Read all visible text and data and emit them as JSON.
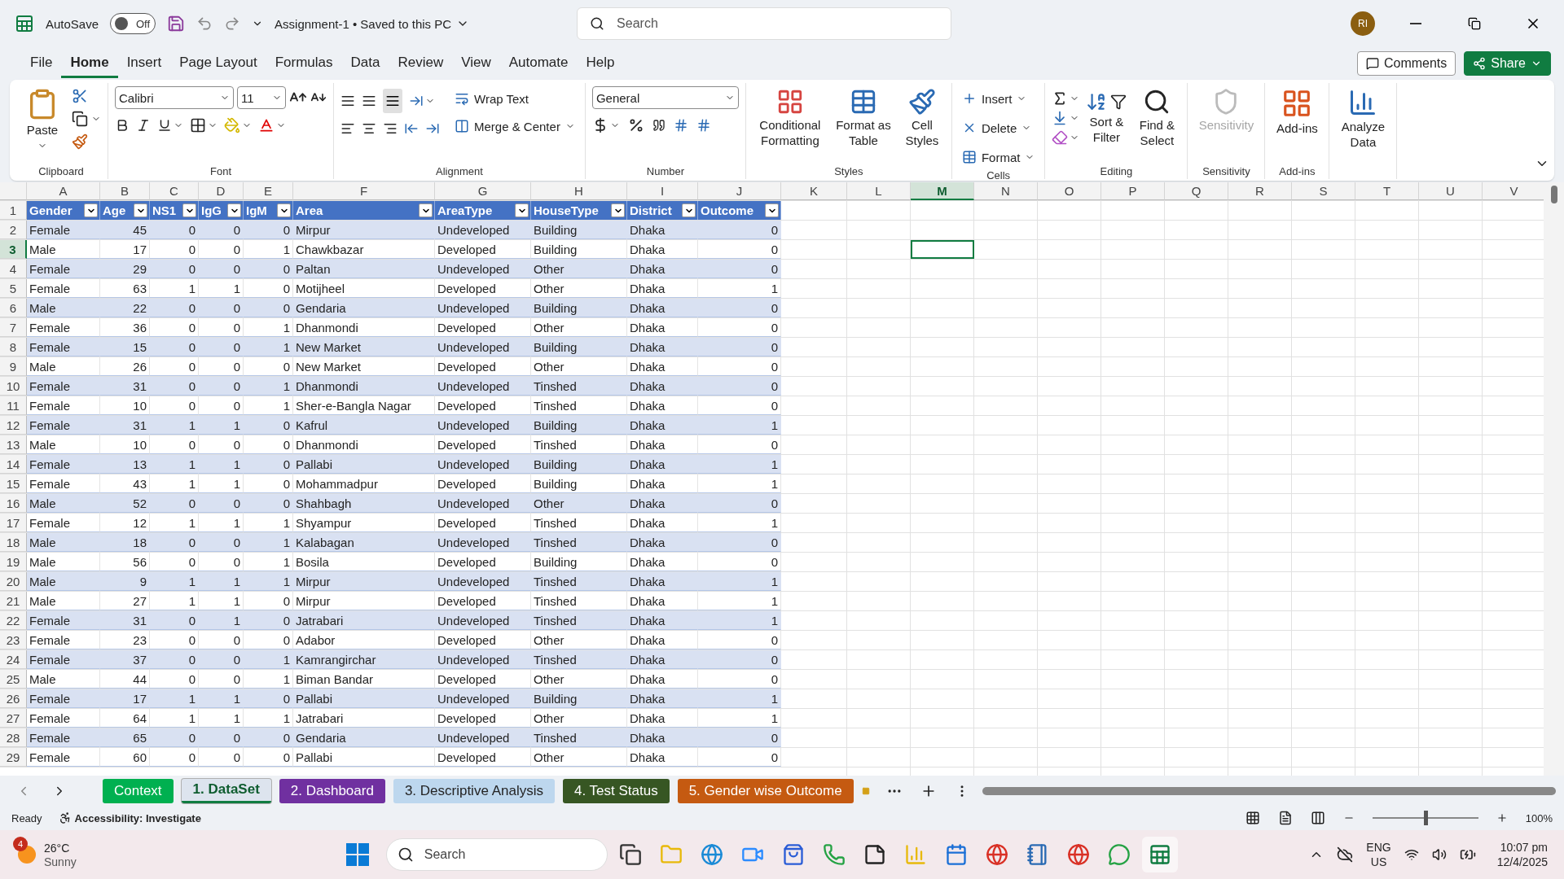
{
  "title_bar": {
    "autosave_label": "AutoSave",
    "autosave": {
      "on": false,
      "label": "Off"
    },
    "document_title": "Assignment-1 • Saved to this PC",
    "search": {
      "placeholder": "Search"
    },
    "avatar": "RI"
  },
  "menu_tabs": [
    {
      "label": "File",
      "selected": false
    },
    {
      "label": "Home",
      "selected": true
    },
    {
      "label": "Insert",
      "selected": false
    },
    {
      "label": "Page Layout",
      "selected": false
    },
    {
      "label": "Formulas",
      "selected": false
    },
    {
      "label": "Data",
      "selected": false
    },
    {
      "label": "Review",
      "selected": false
    },
    {
      "label": "View",
      "selected": false
    },
    {
      "label": "Automate",
      "selected": false
    },
    {
      "label": "Help",
      "selected": false
    }
  ],
  "header_buttons": {
    "comments": "Comments",
    "share": "Share"
  },
  "ribbon": {
    "groups": [
      {
        "kind": "clipboard",
        "label": "Clipboard",
        "commands": [
          "Paste"
        ]
      },
      {
        "kind": "font",
        "label": "Font",
        "font": "Calibri",
        "size": "11"
      },
      {
        "kind": "alignment",
        "label": "Alignment",
        "commands": [
          "Wrap Text",
          "Merge & Center"
        ]
      },
      {
        "kind": "number",
        "label": "Number",
        "format": "General"
      },
      {
        "kind": "styles",
        "label": "Styles",
        "commands": [
          "Conditional Formatting",
          "Format as Table",
          "Cell Styles"
        ]
      },
      {
        "kind": "cells",
        "label": "Cells",
        "commands": [
          "Insert",
          "Delete",
          "Format"
        ]
      },
      {
        "kind": "editing",
        "label": "Editing",
        "commands": [
          "Sort & Filter",
          "Find & Select"
        ]
      },
      {
        "kind": "sensitivity",
        "label": "Sensitivity",
        "commands": [
          "Sensitivity"
        ],
        "disabled": true
      },
      {
        "kind": "addins",
        "label": "Add-ins",
        "commands": [
          "Add-ins"
        ]
      },
      {
        "kind": "analyze",
        "commands": [
          "Analyze Data"
        ]
      }
    ]
  },
  "sheet": {
    "column_letters": [
      {
        "label": "A",
        "selected": false
      },
      {
        "label": "B",
        "selected": false
      },
      {
        "label": "C",
        "selected": false
      },
      {
        "label": "D",
        "selected": false
      },
      {
        "label": "E",
        "selected": false
      },
      {
        "label": "F",
        "selected": false
      },
      {
        "label": "G",
        "selected": false
      },
      {
        "label": "H",
        "selected": false
      },
      {
        "label": "I",
        "selected": false
      },
      {
        "label": "J",
        "selected": false
      },
      {
        "label": "K",
        "selected": false
      },
      {
        "label": "L",
        "selected": false
      },
      {
        "label": "M",
        "selected": true
      },
      {
        "label": "N",
        "selected": false
      },
      {
        "label": "O",
        "selected": false
      },
      {
        "label": "P",
        "selected": false
      },
      {
        "label": "Q",
        "selected": false
      },
      {
        "label": "R",
        "selected": false
      },
      {
        "label": "S",
        "selected": false
      },
      {
        "label": "T",
        "selected": false
      },
      {
        "label": "U",
        "selected": false
      },
      {
        "label": "V",
        "selected": false
      }
    ],
    "header_row": "1",
    "columns": [
      {
        "label": "Gender",
        "kind": "text"
      },
      {
        "label": "Age",
        "kind": "number"
      },
      {
        "label": "NS1",
        "kind": "number"
      },
      {
        "label": "IgG",
        "kind": "number"
      },
      {
        "label": "IgM",
        "kind": "number"
      },
      {
        "label": "Area",
        "kind": "text"
      },
      {
        "label": "AreaType",
        "kind": "text"
      },
      {
        "label": "HouseType",
        "kind": "text"
      },
      {
        "label": "District",
        "kind": "text"
      },
      {
        "label": "Outcome",
        "kind": "number"
      }
    ],
    "rows": [
      {
        "number": "2",
        "selected": false,
        "cells": [
          "Female",
          "45",
          "0",
          "0",
          "0",
          "Mirpur",
          "Undeveloped",
          "Building",
          "Dhaka",
          "0"
        ]
      },
      {
        "number": "3",
        "selected": true,
        "cells": [
          "Male",
          "17",
          "0",
          "0",
          "1",
          "Chawkbazar",
          "Developed",
          "Building",
          "Dhaka",
          "0"
        ]
      },
      {
        "number": "4",
        "selected": false,
        "cells": [
          "Female",
          "29",
          "0",
          "0",
          "0",
          "Paltan",
          "Undeveloped",
          "Other",
          "Dhaka",
          "0"
        ]
      },
      {
        "number": "5",
        "selected": false,
        "cells": [
          "Female",
          "63",
          "1",
          "1",
          "0",
          "Motijheel",
          "Developed",
          "Other",
          "Dhaka",
          "1"
        ]
      },
      {
        "number": "6",
        "selected": false,
        "cells": [
          "Male",
          "22",
          "0",
          "0",
          "0",
          "Gendaria",
          "Undeveloped",
          "Building",
          "Dhaka",
          "0"
        ]
      },
      {
        "number": "7",
        "selected": false,
        "cells": [
          "Female",
          "36",
          "0",
          "0",
          "1",
          "Dhanmondi",
          "Developed",
          "Other",
          "Dhaka",
          "0"
        ]
      },
      {
        "number": "8",
        "selected": false,
        "cells": [
          "Female",
          "15",
          "0",
          "0",
          "1",
          "New Market",
          "Undeveloped",
          "Building",
          "Dhaka",
          "0"
        ]
      },
      {
        "number": "9",
        "selected": false,
        "cells": [
          "Male",
          "26",
          "0",
          "0",
          "0",
          "New Market",
          "Developed",
          "Other",
          "Dhaka",
          "0"
        ]
      },
      {
        "number": "10",
        "selected": false,
        "cells": [
          "Female",
          "31",
          "0",
          "0",
          "1",
          "Dhanmondi",
          "Undeveloped",
          "Tinshed",
          "Dhaka",
          "0"
        ]
      },
      {
        "number": "11",
        "selected": false,
        "cells": [
          "Female",
          "10",
          "0",
          "0",
          "1",
          "Sher-e-Bangla Nagar",
          "Developed",
          "Tinshed",
          "Dhaka",
          "0"
        ]
      },
      {
        "number": "12",
        "selected": false,
        "cells": [
          "Female",
          "31",
          "1",
          "1",
          "0",
          "Kafrul",
          "Undeveloped",
          "Building",
          "Dhaka",
          "1"
        ]
      },
      {
        "number": "13",
        "selected": false,
        "cells": [
          "Male",
          "10",
          "0",
          "0",
          "0",
          "Dhanmondi",
          "Developed",
          "Tinshed",
          "Dhaka",
          "0"
        ]
      },
      {
        "number": "14",
        "selected": false,
        "cells": [
          "Female",
          "13",
          "1",
          "1",
          "0",
          "Pallabi",
          "Undeveloped",
          "Building",
          "Dhaka",
          "1"
        ]
      },
      {
        "number": "15",
        "selected": false,
        "cells": [
          "Female",
          "43",
          "1",
          "1",
          "0",
          "Mohammadpur",
          "Developed",
          "Building",
          "Dhaka",
          "1"
        ]
      },
      {
        "number": "16",
        "selected": false,
        "cells": [
          "Male",
          "52",
          "0",
          "0",
          "0",
          "Shahbagh",
          "Undeveloped",
          "Other",
          "Dhaka",
          "0"
        ]
      },
      {
        "number": "17",
        "selected": false,
        "cells": [
          "Female",
          "12",
          "1",
          "1",
          "1",
          "Shyampur",
          "Developed",
          "Tinshed",
          "Dhaka",
          "1"
        ]
      },
      {
        "number": "18",
        "selected": false,
        "cells": [
          "Male",
          "18",
          "0",
          "0",
          "1",
          "Kalabagan",
          "Undeveloped",
          "Tinshed",
          "Dhaka",
          "0"
        ]
      },
      {
        "number": "19",
        "selected": false,
        "cells": [
          "Male",
          "56",
          "0",
          "0",
          "1",
          "Bosila",
          "Developed",
          "Building",
          "Dhaka",
          "0"
        ]
      },
      {
        "number": "20",
        "selected": false,
        "cells": [
          "Male",
          "9",
          "1",
          "1",
          "1",
          "Mirpur",
          "Undeveloped",
          "Tinshed",
          "Dhaka",
          "1"
        ]
      },
      {
        "number": "21",
        "selected": false,
        "cells": [
          "Male",
          "27",
          "1",
          "1",
          "0",
          "Mirpur",
          "Developed",
          "Tinshed",
          "Dhaka",
          "1"
        ]
      },
      {
        "number": "22",
        "selected": false,
        "cells": [
          "Female",
          "31",
          "0",
          "1",
          "0",
          "Jatrabari",
          "Undeveloped",
          "Tinshed",
          "Dhaka",
          "1"
        ]
      },
      {
        "number": "23",
        "selected": false,
        "cells": [
          "Female",
          "23",
          "0",
          "0",
          "0",
          "Adabor",
          "Developed",
          "Other",
          "Dhaka",
          "0"
        ]
      },
      {
        "number": "24",
        "selected": false,
        "cells": [
          "Female",
          "37",
          "0",
          "0",
          "1",
          "Kamrangirchar",
          "Undeveloped",
          "Tinshed",
          "Dhaka",
          "0"
        ]
      },
      {
        "number": "25",
        "selected": false,
        "cells": [
          "Male",
          "44",
          "0",
          "0",
          "1",
          "Biman Bandar",
          "Developed",
          "Other",
          "Dhaka",
          "0"
        ]
      },
      {
        "number": "26",
        "selected": false,
        "cells": [
          "Female",
          "17",
          "1",
          "1",
          "0",
          "Pallabi",
          "Undeveloped",
          "Building",
          "Dhaka",
          "1"
        ]
      },
      {
        "number": "27",
        "selected": false,
        "cells": [
          "Female",
          "64",
          "1",
          "1",
          "1",
          "Jatrabari",
          "Developed",
          "Other",
          "Dhaka",
          "1"
        ]
      },
      {
        "number": "28",
        "selected": false,
        "cells": [
          "Female",
          "65",
          "0",
          "0",
          "0",
          "Gendaria",
          "Undeveloped",
          "Tinshed",
          "Dhaka",
          "0"
        ]
      },
      {
        "number": "29",
        "selected": false,
        "cells": [
          "Female",
          "60",
          "0",
          "0",
          "0",
          "Pallabi",
          "Developed",
          "Other",
          "Dhaka",
          "0"
        ]
      }
    ]
  },
  "sheet_tabs": [
    {
      "label": "Context",
      "selected": false,
      "color": "#00b050"
    },
    {
      "label": "1. DataSet",
      "selected": true,
      "color": "#dde4ee"
    },
    {
      "label": "2. Dashboard",
      "selected": false,
      "color": "#7030a0"
    },
    {
      "label": "3. Descriptive Analysis",
      "selected": false,
      "color": "#bdd7ee"
    },
    {
      "label": "4. Test Status",
      "selected": false,
      "color": "#375623"
    },
    {
      "label": "5. Gender wise Outcome",
      "selected": false,
      "color": "#c55a11"
    }
  ],
  "status_bar": {
    "ready": "Ready",
    "accessibility": "Accessibility: Investigate",
    "zoom": {
      "level": 0.5,
      "reading": "100%"
    }
  },
  "taskbar": {
    "weather": {
      "badge": "4",
      "temperature": "26°C",
      "condition": "Sunny"
    },
    "search": {
      "placeholder": "Search"
    },
    "language": "ENG",
    "region": "US",
    "time": "10:07 pm",
    "date": "12/4/2025"
  }
}
